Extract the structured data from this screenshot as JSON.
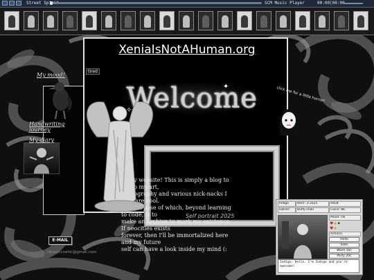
{
  "player": {
    "title": "Street Spirit",
    "name": "SCM Music Player",
    "time": "00:00|00:00"
  },
  "site": {
    "title": "XeniaIsNotAHuman.org",
    "tired_badge": "tired",
    "welcome": "Welcome"
  },
  "sidebar": {
    "mood": "My mood!",
    "handwriting": "Handwriting journey",
    "diary": "My diary",
    "email_button": "E-MAIL",
    "email_address": "idiosyncrattic@gmail.com"
  },
  "intro": {
    "lines": [
      "to my website! This is simply a blog to dump my art,",
      "photography and various nick-nacks I feel, are cool.",
      "The purpose of which, beyond learning to code, is to",
      "make an archive to mark my existence. If neocities exists",
      "forever, then I'll be immortalized here and my future",
      "self can have a look inside my mind (:"
    ]
  },
  "frame_caption": "Self portrait 2025",
  "clickme": "click me for a little horror!",
  "pet": {
    "header": [
      "Indigo",
      "Born: 3-2025",
      "Adult"
    ],
    "row2": [
      "Owner:",
      "Buffy-chan",
      "Coins: 86"
    ],
    "stats_title": "Mood: Ok",
    "actions_title": "Actions:",
    "actions": [
      "Hello",
      "Slots",
      "Wash 10c",
      "Party 20c"
    ],
    "chat": "Indigo: Hello. I'm Indigo and you're awesome!"
  }
}
